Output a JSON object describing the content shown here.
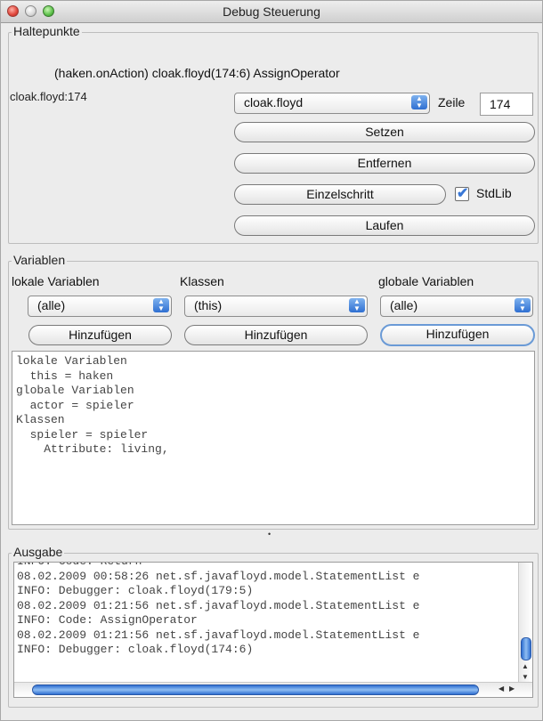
{
  "window": {
    "title": "Debug Steuerung"
  },
  "breakpoints": {
    "legend": "Haltepunkte",
    "current_location": "(haken.onAction) cloak.floyd(174:6)  AssignOperator",
    "list_items": [
      "cloak.floyd:174"
    ],
    "file_select_value": "cloak.floyd",
    "line_label": "Zeile",
    "line_value": "174",
    "set_button": "Setzen",
    "remove_button": "Entfernen",
    "step_button": "Einzelschritt",
    "stdlib_checked": true,
    "stdlib_label": "StdLib",
    "run_button": "Laufen"
  },
  "variables": {
    "legend": "Variablen",
    "local_label": "lokale Variablen",
    "classes_label": "Klassen",
    "global_label": "globale Variablen",
    "local_select": "(alle)",
    "classes_select": "(this)",
    "global_select": "(alle)",
    "add_local": "Hinzufügen",
    "add_class": "Hinzufügen",
    "add_global": "Hinzufügen",
    "output_lines": [
      "lokale Variablen",
      "  this = haken",
      "globale Variablen",
      "  actor = spieler",
      "Klassen",
      "  spieler = spieler",
      "    Attribute: living,"
    ]
  },
  "output": {
    "legend": "Ausgabe",
    "lines": [
      "INFO: Code: Return",
      "08.02.2009 00:58:26 net.sf.javafloyd.model.StatementList e",
      "INFO: Debugger: cloak.floyd(179:5)",
      "08.02.2009 01:21:56 net.sf.javafloyd.model.StatementList e",
      "INFO: Code: AssignOperator",
      "08.02.2009 01:21:56 net.sf.javafloyd.model.StatementList e",
      "INFO: Debugger: cloak.floyd(174:6)"
    ]
  },
  "colors": {
    "accent": "#3a78d6",
    "checkbox": "#3a78d6"
  }
}
